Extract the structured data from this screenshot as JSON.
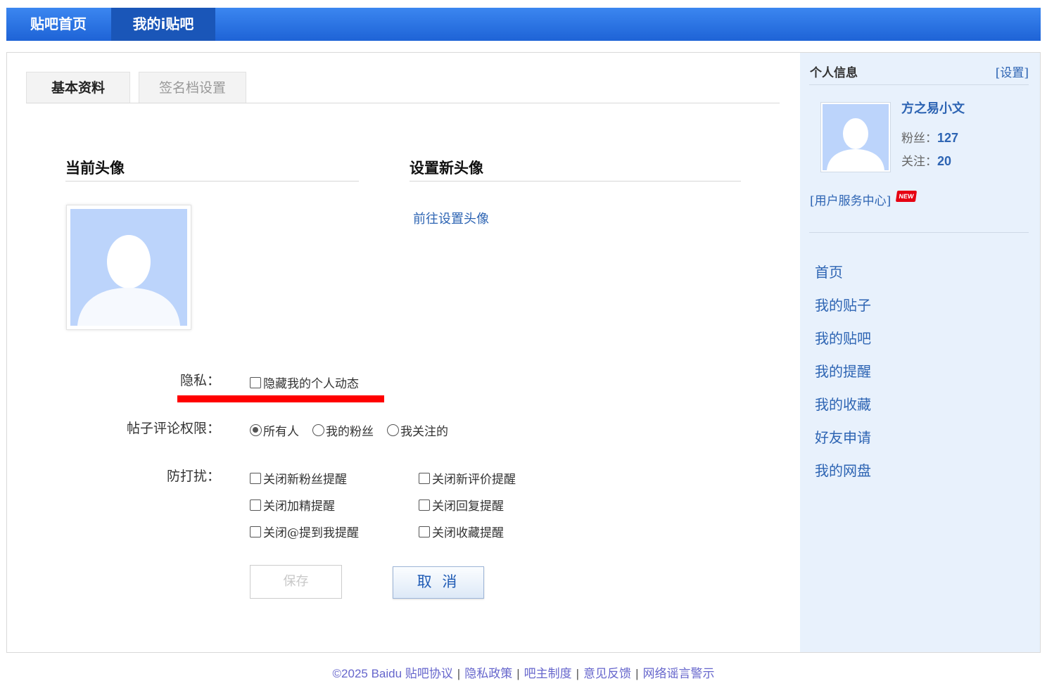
{
  "nav": {
    "home": "贴吧首页",
    "mine": "我的i贴吧"
  },
  "tabs": {
    "basic": "基本资料",
    "signature": "签名档设置"
  },
  "avatar_section": {
    "current_title": "当前头像",
    "new_title": "设置新头像",
    "goto_link": "前往设置头像"
  },
  "privacy": {
    "label": "隐私：",
    "hide_activity": "隐藏我的个人动态",
    "hide_activity_checked": false
  },
  "comment_permission": {
    "label": "帖子评论权限：",
    "options": [
      "所有人",
      "我的粉丝",
      "我关注的"
    ],
    "selected": "所有人"
  },
  "do_not_disturb": {
    "label": "防打扰：",
    "options": [
      "关闭新粉丝提醒",
      "关闭新评价提醒",
      "关闭加精提醒",
      "关闭回复提醒",
      "关闭@提到我提醒",
      "关闭收藏提醒"
    ]
  },
  "buttons": {
    "save": "保存",
    "cancel": "取 消"
  },
  "sidebar": {
    "title": "个人信息",
    "settings": "[设置]",
    "username": "方之易小文",
    "fans_label": "粉丝：",
    "fans": "127",
    "follow_label": "关注：",
    "follow": "20",
    "service_center": "[用户服务中心]",
    "new_badge": "NEW",
    "menu": [
      "首页",
      "我的贴子",
      "我的贴吧",
      "我的提醒",
      "我的收藏",
      "好友申请",
      "我的网盘"
    ]
  },
  "footer": {
    "copyright": "©2025 Baidu",
    "links": [
      "贴吧协议",
      "隐私政策",
      "吧主制度",
      "意见反馈",
      "网络谣言警示"
    ]
  },
  "colors": {
    "nav_blue": "#1e63d6",
    "link_blue": "#2d64b3",
    "sidebar_bg": "#e8f1fc",
    "highlight_red": "#ff0000"
  }
}
